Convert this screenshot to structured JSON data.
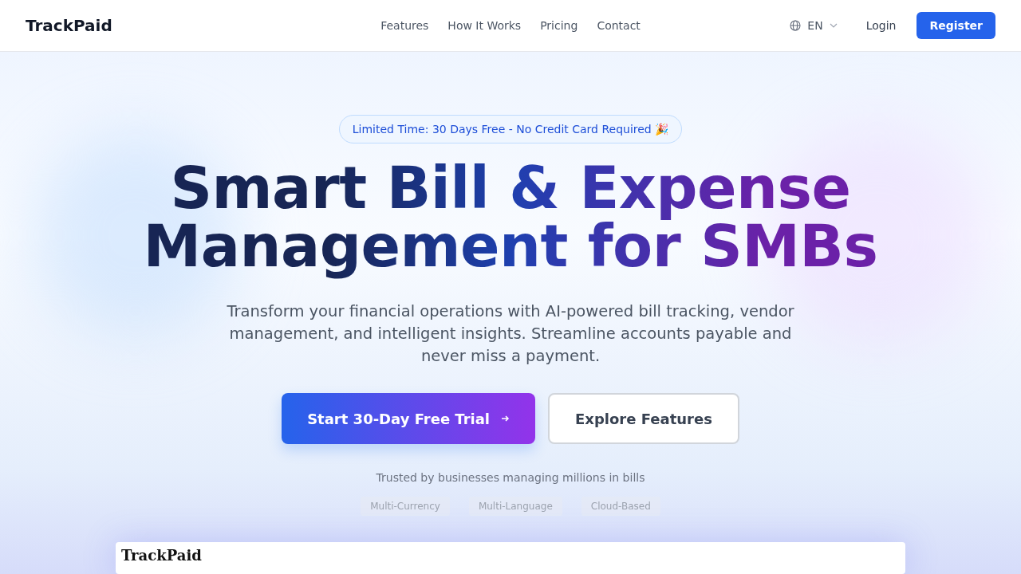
{
  "brand": "TrackPaid",
  "nav": [
    "Features",
    "How It Works",
    "Pricing",
    "Contact"
  ],
  "language": "EN",
  "login": "Login",
  "register": "Register",
  "badge": "Limited Time: 30 Days Free - No Credit Card Required 🎉",
  "headline": [
    "Smart Bill & Expense",
    "Management for SMBs"
  ],
  "subtitle": "Transform your financial operations with AI-powered bill tracking, vendor management, and intelligent insights. Streamline accounts payable and never miss a payment.",
  "primary_cta": "Start 30-Day Free Trial",
  "secondary_cta": "Explore Features",
  "trust_text": "Trusted by businesses managing millions in bills",
  "tags": [
    "Multi-Currency",
    "Multi-Language",
    "Cloud-Based"
  ],
  "preview": {
    "title": "TrackPaid"
  }
}
